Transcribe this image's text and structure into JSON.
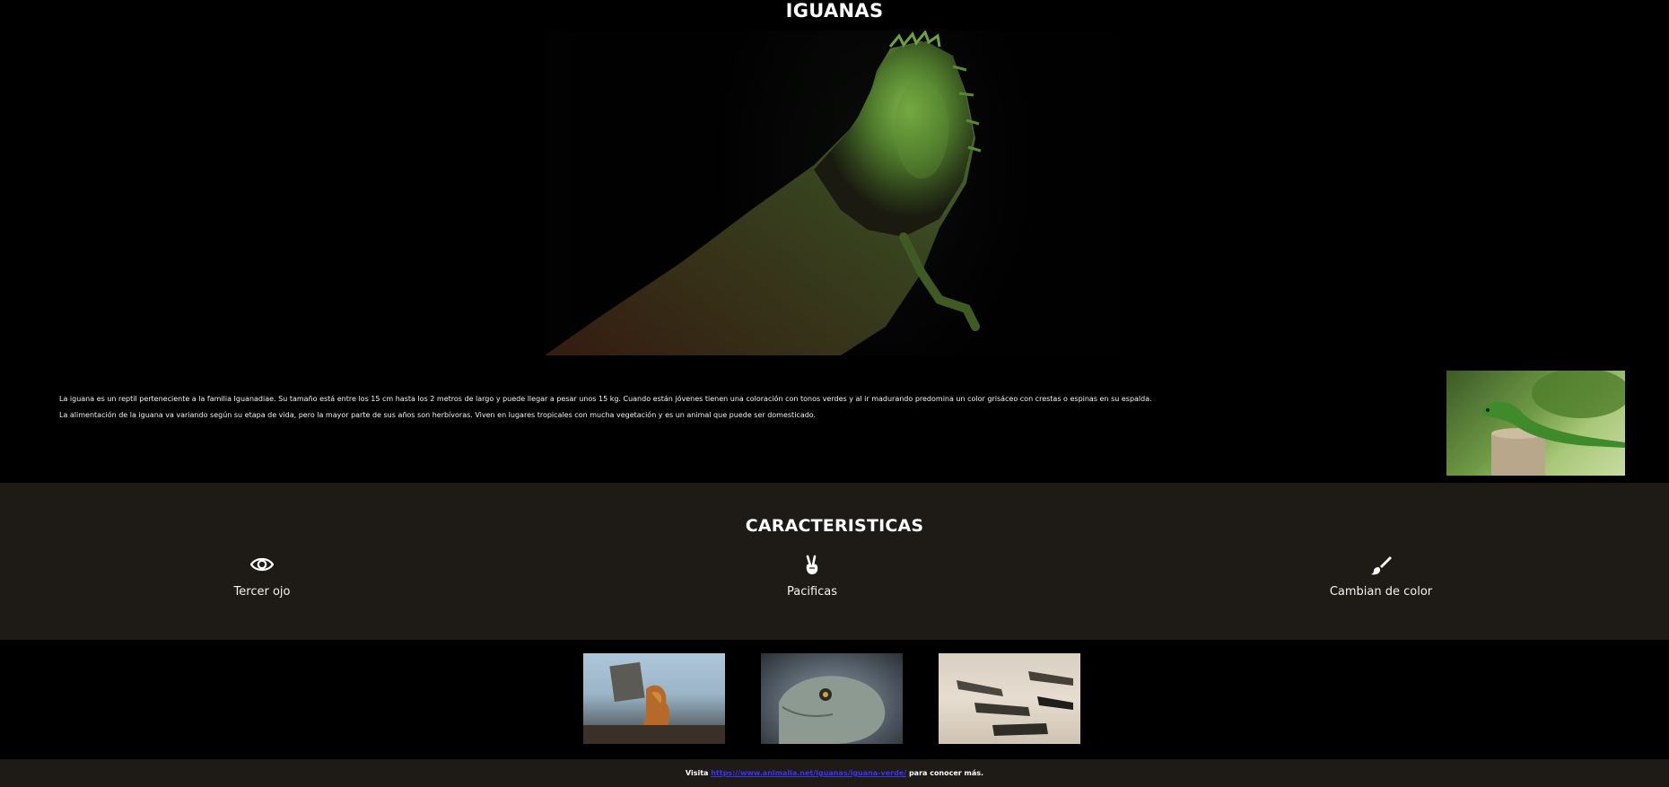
{
  "header": {
    "title": "IGUANAS"
  },
  "intro": {
    "paragraph_1": "La iguana es un reptil perteneciente a la familia Iguanadiae. Su tamaño está entre los 15 cm hasta los 2 metros de largo y puede llegar a pesar unos 15 kg. Cuando están jóvenes tienen una coloración con tonos verdes y al ir madurando predomina un color grisáceo con crestas o espinas en su espalda.",
    "paragraph_2": "La alimentación de la iguana va variando según su etapa de vida, pero la mayor parte de sus años son herbívoras. Viven en lugares tropicales con mucha vegetación y es un animal que puede ser domesticado."
  },
  "features": {
    "title": "CARACTERISTICAS",
    "items": [
      {
        "label": "Tercer ojo",
        "icon": "eye-icon"
      },
      {
        "label": "Pacificas",
        "icon": "peace-hand-icon"
      },
      {
        "label": "Cambian de color",
        "icon": "paintbrush-icon"
      }
    ]
  },
  "footer": {
    "prefix": "Visita ",
    "link_text": "https://www.animalia.net/iguanas/iguana-verde/",
    "suffix": " para conocer más."
  },
  "colors": {
    "background": "#000000",
    "section_background": "#1e1b16",
    "link": "#3b34f0",
    "text": "#ffffff"
  }
}
